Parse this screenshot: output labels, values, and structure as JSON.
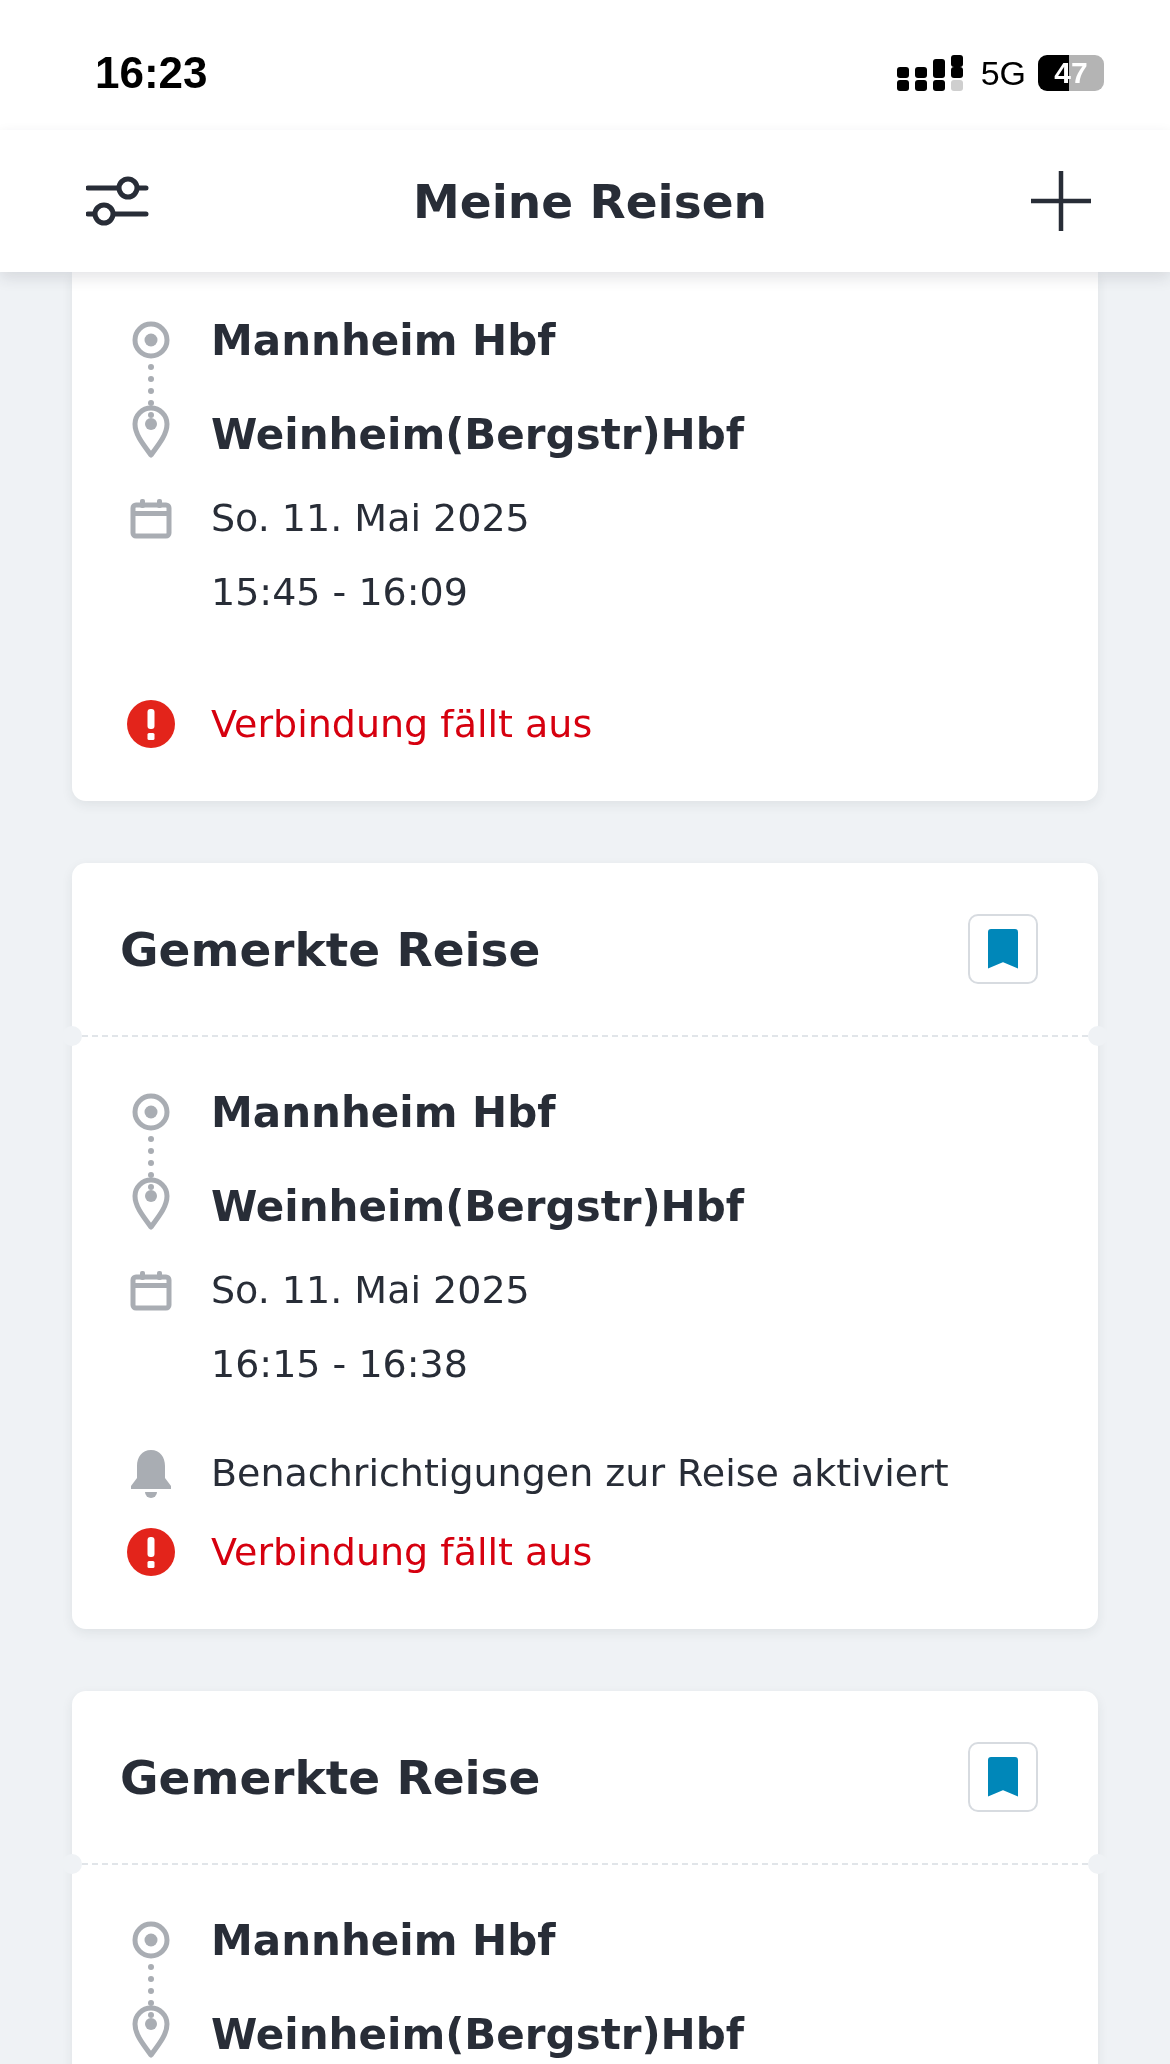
{
  "status_bar": {
    "time": "16:23",
    "network": "5G",
    "battery": "47"
  },
  "header": {
    "title": "Meine Reisen"
  },
  "trips": [
    {
      "from": "Mannheim Hbf",
      "to": "Weinheim(Bergstr)Hbf",
      "date": "So. 11. Mai 2025",
      "time": "15:45 - 16:09",
      "alert": "Verbindung fällt aus"
    },
    {
      "title": "Gemerkte Reise",
      "bookmarked": true,
      "from": "Mannheim Hbf",
      "to": "Weinheim(Bergstr)Hbf",
      "date": "So. 11. Mai 2025",
      "time": "16:15 - 16:38",
      "notification": "Benachrichtigungen zur Reise aktiviert",
      "alert": "Verbindung fällt aus"
    },
    {
      "title": "Gemerkte Reise",
      "bookmarked": true,
      "from": "Mannheim Hbf",
      "to": "Weinheim(Bergstr)Hbf"
    }
  ]
}
